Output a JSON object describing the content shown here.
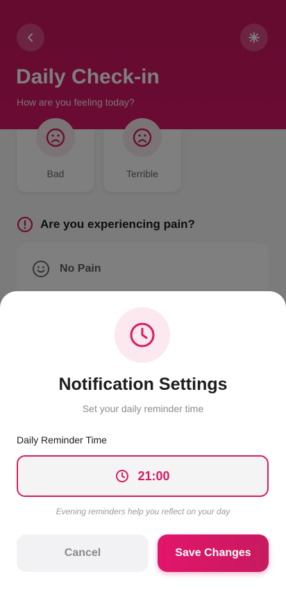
{
  "header": {
    "title": "Daily Check-in",
    "subtitle": "How are you feeling today?"
  },
  "moods": [
    {
      "label": "Bad",
      "icon": "sad-face-icon"
    },
    {
      "label": "Terrible",
      "icon": "sad-face-icon"
    }
  ],
  "pain": {
    "question": "Are you experiencing pain?",
    "option": "No Pain"
  },
  "sheet": {
    "title": "Notification Settings",
    "subtitle": "Set your daily reminder time",
    "field_label": "Daily Reminder Time",
    "time_value": "21:00",
    "hint": "Evening reminders help you reflect on your day",
    "cancel_label": "Cancel",
    "save_label": "Save Changes"
  },
  "colors": {
    "accent": "#d81b60",
    "header": "#c9175f"
  }
}
